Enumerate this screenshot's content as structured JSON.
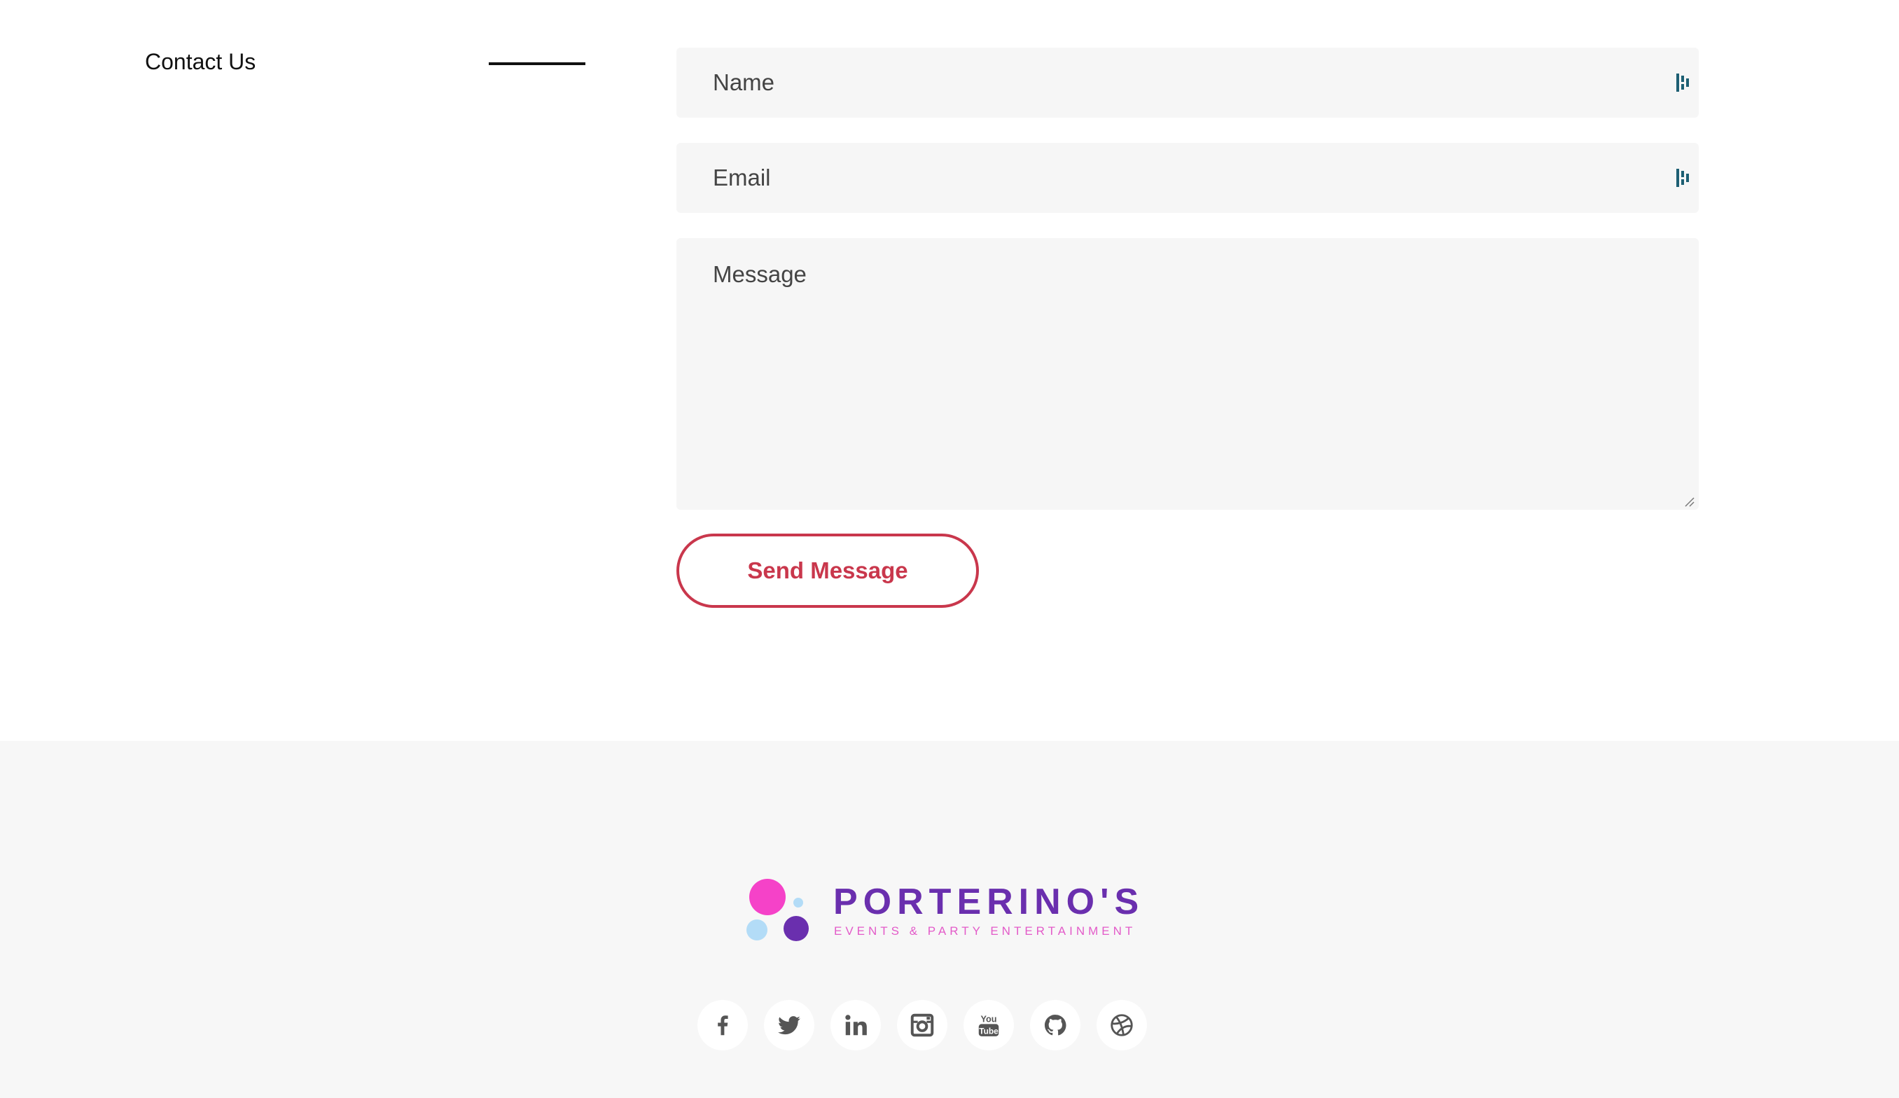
{
  "contact": {
    "heading": "Contact Us",
    "name_placeholder": "Name",
    "email_placeholder": "Email",
    "message_placeholder": "Message",
    "send_label": "Send Message"
  },
  "footer": {
    "logo_name": "PORTERINO'S",
    "logo_tagline": "EVENTS & PARTY ENTERTAINMENT",
    "social_icons": [
      "facebook-icon",
      "twitter-icon",
      "linkedin-icon",
      "instagram-icon",
      "youtube-icon",
      "github-icon",
      "dribbble-icon"
    ]
  },
  "colors": {
    "accent": "#c9374c",
    "field_bg": "#f6f6f6",
    "footer_bg": "#f7f7f7",
    "logo_purple": "#6a2fae",
    "logo_pink": "#f542c8",
    "logo_light_blue": "#b3dcf7",
    "field_icon": "#1d5f73",
    "social_icon": "#555555"
  }
}
